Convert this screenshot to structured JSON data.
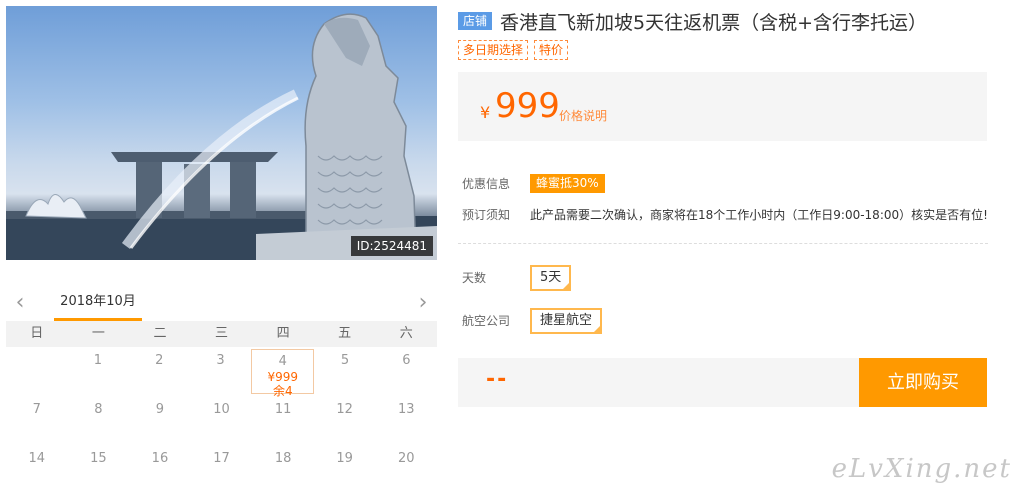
{
  "hero": {
    "image_id": "ID:2524481"
  },
  "calendar": {
    "month": "2018年10月",
    "weekdays": [
      "日",
      "一",
      "二",
      "三",
      "四",
      "五",
      "六"
    ],
    "rows": [
      [
        "",
        "1",
        "2",
        "3",
        "4",
        "5",
        "6"
      ],
      [
        "7",
        "8",
        "9",
        "10",
        "11",
        "12",
        "13"
      ],
      [
        "14",
        "15",
        "16",
        "17",
        "18",
        "19",
        "20"
      ]
    ],
    "active_price": "¥999",
    "active_stock": "余4"
  },
  "product": {
    "shop_tag": "店铺",
    "title": "香港直飞新加坡5天往返机票（含税+含行李托运）",
    "tags": [
      "多日期选择",
      "特价"
    ],
    "price_symbol": "¥",
    "price": "999",
    "price_note": "价格说明",
    "promo_label": "优惠信息",
    "promo_badge": "蜂蜜抵30%",
    "notice_label": "预订须知",
    "notice_text": "此产品需要二次确认，商家将在18个工作小时内（工作日9:00-18:00）核实是否有位!",
    "days_label": "天数",
    "days_value": "5天",
    "airline_label": "航空公司",
    "airline_value": "捷星航空",
    "total_placeholder": "--",
    "buy_label": "立即购买"
  },
  "watermark": "eLvXing.net",
  "colors": {
    "accent": "#ff9900",
    "price": "#ff6600",
    "shop_tag": "#5b9be6"
  }
}
